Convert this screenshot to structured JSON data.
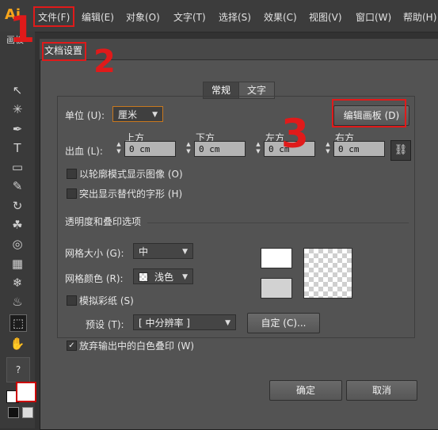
{
  "app": {
    "logo": "Ai"
  },
  "menu": [
    "文件(F)",
    "编辑(E)",
    "对象(O)",
    "文字(T)",
    "选择(S)",
    "效果(C)",
    "视图(V)",
    "窗口(W)",
    "帮助(H)"
  ],
  "left_panel": {
    "tab_label": "画板",
    "help_glyph": "?"
  },
  "dialog": {
    "title": "文档设置",
    "tabs": {
      "general": "常规",
      "text": "文字"
    },
    "unit": {
      "label": "单位 (U):",
      "value": "厘米"
    },
    "edit_artboards_button": "编辑画板 (D)",
    "bleed": {
      "label": "出血 (L):",
      "top": {
        "label": "上方",
        "value": "0 cm"
      },
      "bottom": {
        "label": "下方",
        "value": "0 cm"
      },
      "left": {
        "label": "左方",
        "value": "0 cm"
      },
      "right": {
        "label": "右方",
        "value": "0 cm"
      }
    },
    "checks": {
      "outline_mode": {
        "label": "以轮廓模式显示图像 (O)",
        "checked": false
      },
      "highlight_glyphs": {
        "label": "突出显示替代的字形 (H)",
        "checked": false
      }
    },
    "transparency": {
      "section_title": "透明度和叠印选项",
      "grid_size": {
        "label": "网格大小 (G):",
        "value": "中"
      },
      "grid_colors": {
        "label": "网格颜色 (R):",
        "value": "浅色"
      },
      "simulate_paper": {
        "label": "模拟彩纸 (S)",
        "checked": false
      },
      "preset": {
        "label": "预设 (T):",
        "value": "[ 中分辨率 ]"
      },
      "custom_button": "自定 (C)...",
      "discard_white": {
        "label": "放弃输出中的白色叠印 (W)",
        "checked": true
      }
    },
    "ok_button": "确定",
    "cancel_button": "取消"
  },
  "annotations": {
    "step1": "1",
    "step2": "2",
    "step3": "3",
    "color": "#e01a1a"
  },
  "colors": {
    "accent_orange": "#f7a51b",
    "dialog_bg": "#535353",
    "unit_border": "#c8781e"
  }
}
